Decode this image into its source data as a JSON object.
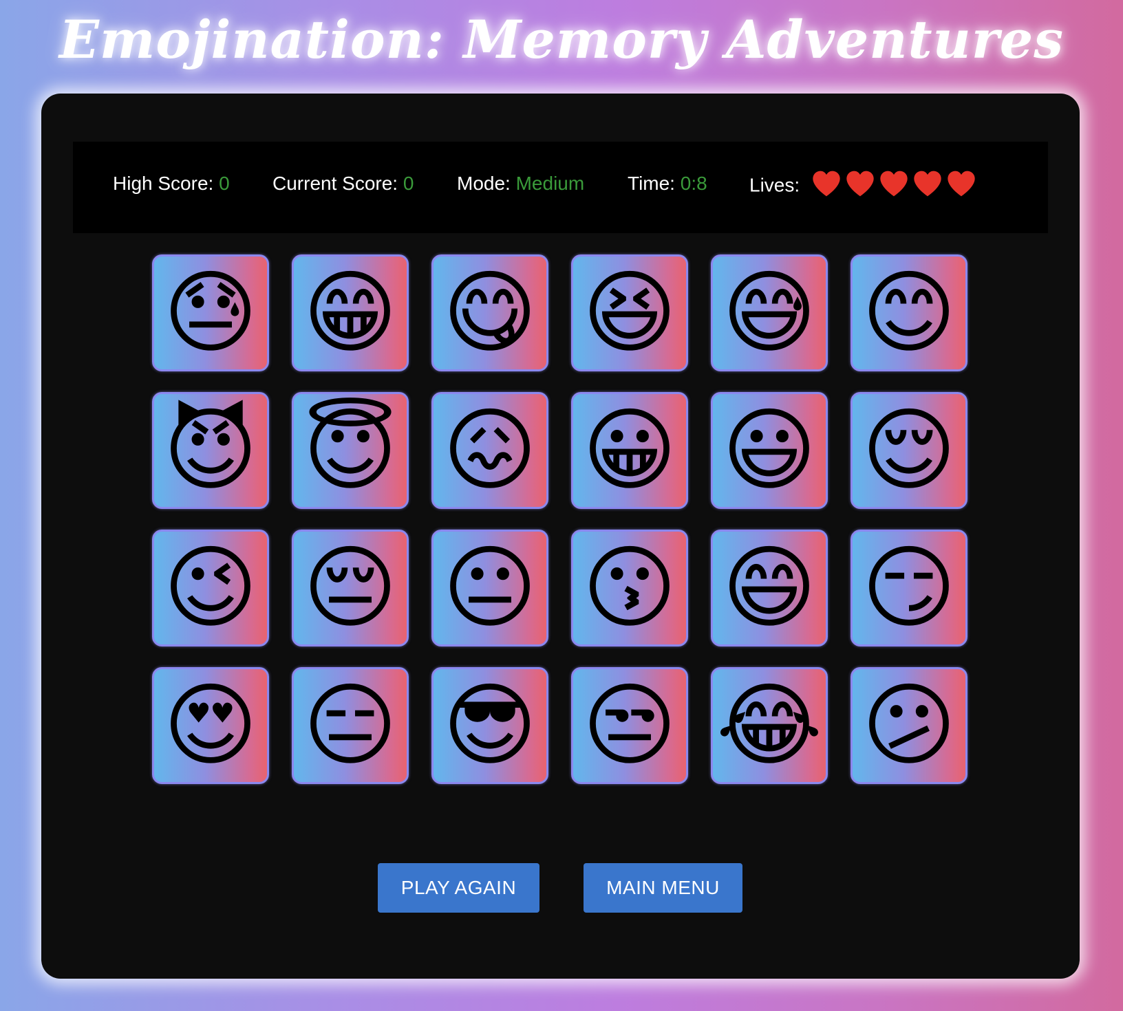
{
  "title": "Emojination: Memory Adventures",
  "status": {
    "high_score_label": "High Score:",
    "high_score_value": "0",
    "current_score_label": "Current Score:",
    "current_score_value": "0",
    "mode_label": "Mode:",
    "mode_value": "Medium",
    "time_label": "Time:",
    "time_value": "0:8",
    "lives_label": "Lives:",
    "lives_count": 5,
    "lives_icon": "heart-icon"
  },
  "cards": [
    {
      "emoji": "😓",
      "name": "downcast-face-with-sweat"
    },
    {
      "emoji": "😁",
      "name": "beaming-face"
    },
    {
      "emoji": "😋",
      "name": "face-savoring-food"
    },
    {
      "emoji": "😆",
      "name": "grinning-squinting-face"
    },
    {
      "emoji": "😅",
      "name": "grinning-face-with-sweat"
    },
    {
      "emoji": "😊",
      "name": "smiling-face-with-smiling-eyes"
    },
    {
      "emoji": "😈",
      "name": "smiling-face-with-horns"
    },
    {
      "emoji": "😇",
      "name": "smiling-face-with-halo"
    },
    {
      "emoji": "😖",
      "name": "confounded-face"
    },
    {
      "emoji": "😀",
      "name": "grinning-face"
    },
    {
      "emoji": "😃",
      "name": "grinning-face-with-big-eyes"
    },
    {
      "emoji": "😌",
      "name": "relieved-face"
    },
    {
      "emoji": "😉",
      "name": "winking-face"
    },
    {
      "emoji": "😔",
      "name": "pensive-face"
    },
    {
      "emoji": "😐",
      "name": "neutral-face"
    },
    {
      "emoji": "😗",
      "name": "kissing-face"
    },
    {
      "emoji": "😄",
      "name": "grinning-face-with-smiling-eyes"
    },
    {
      "emoji": "😏",
      "name": "smirking-face"
    },
    {
      "emoji": "😍",
      "name": "smiling-face-with-heart-eyes"
    },
    {
      "emoji": "😑",
      "name": "expressionless-face"
    },
    {
      "emoji": "😎",
      "name": "smiling-face-with-sunglasses"
    },
    {
      "emoji": "😒",
      "name": "unamused-face"
    },
    {
      "emoji": "😂",
      "name": "face-with-tears-of-joy"
    },
    {
      "emoji": "😕",
      "name": "confused-face"
    }
  ],
  "buttons": {
    "play_again": "PLAY AGAIN",
    "main_menu": "MAIN MENU"
  },
  "colors": {
    "value_green": "#3a9a3a",
    "heart_red": "#e8342a",
    "button_blue": "#3a76cc",
    "board_bg": "#0d0d0d"
  }
}
